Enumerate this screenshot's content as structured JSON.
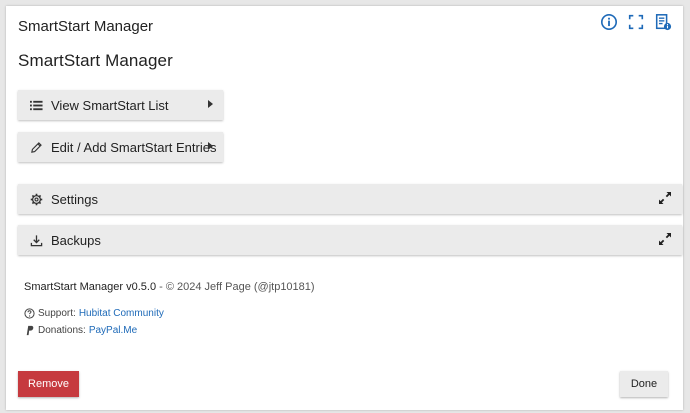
{
  "window": {
    "title": "SmartStart Manager"
  },
  "top_icons": [
    "info-icon",
    "fullscreen-icon",
    "document-info-icon"
  ],
  "page": {
    "title": "SmartStart Manager"
  },
  "sections": {
    "view_list": {
      "label": "View SmartStart List",
      "icon": "list-icon"
    },
    "edit_add": {
      "label": "Edit / Add SmartStart Entries",
      "icon": "pencil-icon"
    },
    "settings": {
      "label": "Settings",
      "icon": "gear-icon"
    },
    "backups": {
      "label": "Backups",
      "icon": "download-icon"
    }
  },
  "footer": {
    "app_version": "SmartStart Manager v0.5.0",
    "copyright": "- © 2024 Jeff Page (@jtp10181)",
    "support_label": "Support:",
    "support_link": "Hubitat Community",
    "donations_label": "Donations:",
    "donations_link": "PayPal.Me"
  },
  "buttons": {
    "remove": "Remove",
    "done": "Done"
  },
  "colors": {
    "accent": "#1e6ab8",
    "danger": "#c63a3f",
    "button_bg": "#ebebeb"
  }
}
